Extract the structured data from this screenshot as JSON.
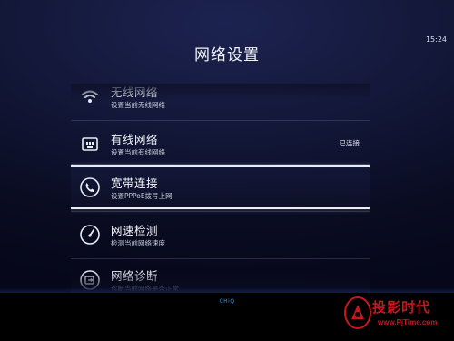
{
  "status_bar": {
    "time": "15:24"
  },
  "page": {
    "title": "网络设置"
  },
  "menu": {
    "items": [
      {
        "name": "无线网络",
        "desc": "设置当前无线网络",
        "status": "",
        "icon": "wifi-icon"
      },
      {
        "name": "有线网络",
        "desc": "设置当前有线网络",
        "status": "已连接",
        "icon": "ethernet-icon"
      },
      {
        "name": "宽带连接",
        "desc": "设置PPPoE拨号上网",
        "status": "",
        "icon": "phone-icon"
      },
      {
        "name": "网速检测",
        "desc": "检测当前网络速度",
        "status": "",
        "icon": "speedometer-icon"
      },
      {
        "name": "网络诊断",
        "desc": "诊断当前网络是否正常",
        "status": "",
        "icon": "diagnosis-icon"
      }
    ],
    "focused_index": 2
  },
  "footer": {
    "brand": "CHiQ"
  },
  "watermark": {
    "text": "投影时代",
    "url": "www.PjTime.com"
  },
  "colors": {
    "focus_border": "#e9ecf5",
    "watermark_red": "#c8161d",
    "brand_blue": "#3d8fe0"
  }
}
